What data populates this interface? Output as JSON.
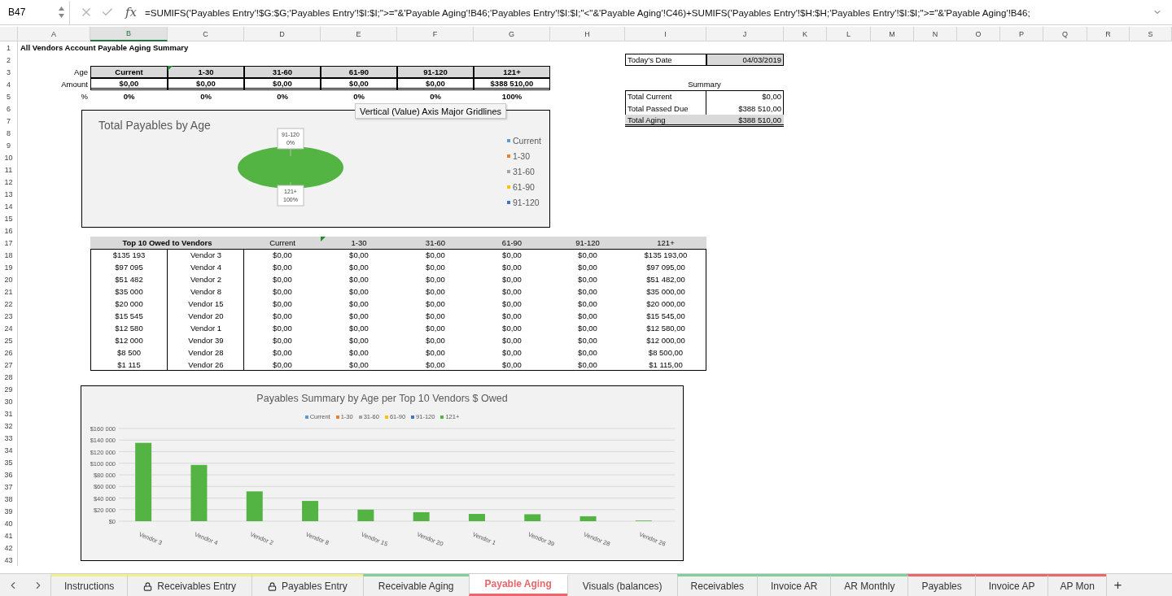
{
  "formula_bar": {
    "cell_ref": "B47",
    "function_label": "fx",
    "formula": "=SUMIFS('Payables Entry'!$G:$G;'Payables Entry'!$I:$I;\">=\"&'Payable Aging'!B46;'Payables Entry'!$I:$I;\"<\"&'Payable Aging'!C46)+SUMIFS('Payables Entry'!$H:$H;'Payables Entry'!$I:$I;\">=\"&'Payable Aging'!B46;"
  },
  "columns": [
    {
      "label": "A",
      "selected": false
    },
    {
      "label": "B",
      "selected": true
    },
    {
      "label": "C",
      "selected": false
    },
    {
      "label": "D",
      "selected": false
    },
    {
      "label": "E",
      "selected": false
    },
    {
      "label": "F",
      "selected": false
    },
    {
      "label": "G",
      "selected": false
    },
    {
      "label": "H",
      "selected": false
    },
    {
      "label": "I",
      "selected": false
    },
    {
      "label": "J",
      "selected": false
    },
    {
      "label": "K",
      "selected": false
    },
    {
      "label": "L",
      "selected": false
    },
    {
      "label": "M",
      "selected": false
    },
    {
      "label": "N",
      "selected": false
    },
    {
      "label": "O",
      "selected": false
    },
    {
      "label": "P",
      "selected": false
    },
    {
      "label": "Q",
      "selected": false
    },
    {
      "label": "R",
      "selected": false
    },
    {
      "label": "S",
      "selected": false
    }
  ],
  "rows": [
    "1",
    "2",
    "3",
    "4",
    "5",
    "6",
    "7",
    "8",
    "9",
    "10",
    "11",
    "12",
    "13",
    "14",
    "15",
    "16",
    "17",
    "18",
    "19",
    "20",
    "21",
    "22",
    "23",
    "24",
    "25",
    "26",
    "27",
    "28",
    "29",
    "30",
    "31",
    "32",
    "33",
    "34",
    "35",
    "36",
    "37",
    "38",
    "39",
    "40",
    "41",
    "42",
    "43"
  ],
  "title": "All Vendors Account Payable Aging Summary",
  "aging": {
    "labels": [
      "Age",
      "Amount",
      "%"
    ],
    "buckets": [
      "Current",
      "1-30",
      "31-60",
      "61-90",
      "91-120",
      "121+"
    ],
    "amounts": [
      "$0,00",
      "$0,00",
      "$0,00",
      "$0,00",
      "$0,00",
      "$388 510,00"
    ],
    "percents": [
      "0%",
      "0%",
      "0%",
      "0%",
      "0%",
      "100%"
    ]
  },
  "todays_date": {
    "label": "Today's Date",
    "value": "04/03/2019"
  },
  "summary": {
    "title": "Summary",
    "rows": [
      {
        "label": "Total Current",
        "value": "$0,00",
        "kind": "normal"
      },
      {
        "label": "Total Passed Due",
        "value": "$388 510,00",
        "kind": "normal"
      },
      {
        "label": "Total Aging",
        "value": "$388 510,00",
        "kind": "total"
      }
    ]
  },
  "tooltip": "Vertical (Value) Axis Major Gridlines",
  "pie_chart": {
    "legend_overflow": true,
    "chart_data": {
      "type": "pie",
      "title": "Total Payables by Age",
      "categories": [
        "Current",
        "1-30",
        "31-60",
        "61-90",
        "91-120",
        "121+"
      ],
      "values": [
        0,
        0,
        0,
        0,
        0,
        100
      ],
      "value_labels": [
        null,
        null,
        null,
        null,
        "0%",
        "100%"
      ],
      "colors": [
        "#5b9bd5",
        "#ed7d31",
        "#a5a5a5",
        "#ffc000",
        "#4472c4",
        "#53b443"
      ]
    }
  },
  "top_vendors": {
    "columns": [
      "Top 10 Owed to Vendors",
      "Current",
      "1-30",
      "31-60",
      "61-90",
      "91-120",
      "121+"
    ],
    "rows": [
      {
        "owed": "$135 193",
        "vendor": "Vendor 3",
        "values": [
          "$0,00",
          "$0,00",
          "$0,00",
          "$0,00",
          "$0,00",
          "$135 193,00"
        ]
      },
      {
        "owed": "$97 095",
        "vendor": "Vendor 4",
        "values": [
          "$0,00",
          "$0,00",
          "$0,00",
          "$0,00",
          "$0,00",
          "$97 095,00"
        ]
      },
      {
        "owed": "$51 482",
        "vendor": "Vendor 2",
        "values": [
          "$0,00",
          "$0,00",
          "$0,00",
          "$0,00",
          "$0,00",
          "$51 482,00"
        ]
      },
      {
        "owed": "$35 000",
        "vendor": "Vendor 8",
        "values": [
          "$0,00",
          "$0,00",
          "$0,00",
          "$0,00",
          "$0,00",
          "$35 000,00"
        ]
      },
      {
        "owed": "$20 000",
        "vendor": "Vendor 15",
        "values": [
          "$0,00",
          "$0,00",
          "$0,00",
          "$0,00",
          "$0,00",
          "$20 000,00"
        ]
      },
      {
        "owed": "$15 545",
        "vendor": "Vendor 20",
        "values": [
          "$0,00",
          "$0,00",
          "$0,00",
          "$0,00",
          "$0,00",
          "$15 545,00"
        ]
      },
      {
        "owed": "$12 580",
        "vendor": "Vendor 1",
        "values": [
          "$0,00",
          "$0,00",
          "$0,00",
          "$0,00",
          "$0,00",
          "$12 580,00"
        ]
      },
      {
        "owed": "$12 000",
        "vendor": "Vendor 39",
        "values": [
          "$0,00",
          "$0,00",
          "$0,00",
          "$0,00",
          "$0,00",
          "$12 000,00"
        ]
      },
      {
        "owed": "$8 500",
        "vendor": "Vendor 28",
        "values": [
          "$0,00",
          "$0,00",
          "$0,00",
          "$0,00",
          "$0,00",
          "$8 500,00"
        ]
      },
      {
        "owed": "$1 115",
        "vendor": "Vendor 26",
        "values": [
          "$0,00",
          "$0,00",
          "$0,00",
          "$0,00",
          "$0,00",
          "$1 115,00"
        ]
      }
    ]
  },
  "bar_chart": {
    "chart_data": {
      "type": "bar",
      "title": "Payables Summary by Age per Top 10 Vendors $ Owed",
      "categories": [
        "Vendor 3",
        "Vendor 4",
        "Vendor 2",
        "Vendor 8",
        "Vendor 15",
        "Vendor 20",
        "Vendor 1",
        "Vendor 39",
        "Vendor 28",
        "Vendor 26"
      ],
      "series": [
        {
          "name": "Current",
          "color": "#5b9bd5",
          "values": [
            0,
            0,
            0,
            0,
            0,
            0,
            0,
            0,
            0,
            0
          ]
        },
        {
          "name": "1-30",
          "color": "#ed7d31",
          "values": [
            0,
            0,
            0,
            0,
            0,
            0,
            0,
            0,
            0,
            0
          ]
        },
        {
          "name": "31-60",
          "color": "#a5a5a5",
          "values": [
            0,
            0,
            0,
            0,
            0,
            0,
            0,
            0,
            0,
            0
          ]
        },
        {
          "name": "61-90",
          "color": "#ffc000",
          "values": [
            0,
            0,
            0,
            0,
            0,
            0,
            0,
            0,
            0,
            0
          ]
        },
        {
          "name": "91-120",
          "color": "#4472c4",
          "values": [
            0,
            0,
            0,
            0,
            0,
            0,
            0,
            0,
            0,
            0
          ]
        },
        {
          "name": "121+",
          "color": "#53b443",
          "values": [
            135193,
            97095,
            51482,
            35000,
            20000,
            15545,
            12580,
            12000,
            8500,
            1115
          ]
        }
      ],
      "ylim": [
        0,
        160000
      ],
      "grid": true,
      "yticks": [
        {
          "value": 0,
          "label": "$0"
        },
        {
          "value": 20000,
          "label": "$20 000"
        },
        {
          "value": 40000,
          "label": "$40 000"
        },
        {
          "value": 60000,
          "label": "$60 000"
        },
        {
          "value": 80000,
          "label": "$80 000"
        },
        {
          "value": 100000,
          "label": "$100 000"
        },
        {
          "value": 120000,
          "label": "$120 000"
        },
        {
          "value": 140000,
          "label": "$140 000"
        },
        {
          "value": 160000,
          "label": "$160 000"
        }
      ]
    }
  },
  "sheet_tabs": [
    {
      "label": "Instructions",
      "color": "#f2f08a",
      "locked": false,
      "selected": false
    },
    {
      "label": "Receivables Entry",
      "color": "#f2f08a",
      "locked": true,
      "selected": false
    },
    {
      "label": "Payables Entry",
      "color": "#f2f08a",
      "locked": true,
      "selected": false
    },
    {
      "label": "Receivable Aging",
      "color": "#7fcf9b",
      "locked": false,
      "selected": false
    },
    {
      "label": "Payable Aging",
      "color": "#e8676b",
      "locked": false,
      "selected": true
    },
    {
      "label": "Visuals (balances)",
      "color": "#f0f0f0",
      "locked": false,
      "selected": false
    },
    {
      "label": "Receivables",
      "color": "#7fcf9b",
      "locked": false,
      "selected": false
    },
    {
      "label": "Invoice AR",
      "color": "#7fcf9b",
      "locked": false,
      "selected": false
    },
    {
      "label": "AR Monthly",
      "color": "#7fcf9b",
      "locked": false,
      "selected": false
    },
    {
      "label": "Payables",
      "color": "#e8676b",
      "locked": false,
      "selected": false
    },
    {
      "label": "Invoice AP",
      "color": "#e8676b",
      "locked": false,
      "selected": false
    },
    {
      "label": "AP Mon",
      "color": "#e8676b",
      "locked": false,
      "selected": false
    }
  ],
  "add_sheet": "+"
}
